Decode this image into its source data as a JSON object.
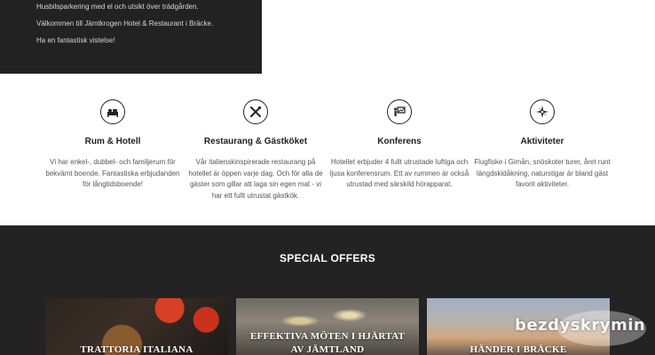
{
  "intro": {
    "lines": [
      "Husbilsparkering med el och utsikt över trädgården.",
      "Välkommen till Jämtkrogen Hotel & Restaurant i Bräcke.",
      "Ha en fantastisk vistelse!"
    ]
  },
  "features": [
    {
      "icon": "bed-icon",
      "title": "Rum & Hotell",
      "desc": "Vi har enkel-, dubbel- och familjerum för bekvämt boende. Fantastiska erbjudanden för långtidsboende!"
    },
    {
      "icon": "cutlery-icon",
      "title": "Restaurang & Gästköket",
      "desc": "Vår italienskinspirerade restaurang på hotellet är öppen varje dag. Och för alla de gäster som gillar att laga sin egen mat - vi har ett fullt utrustat gästkök."
    },
    {
      "icon": "presentation-icon",
      "title": "Konferens",
      "desc": "Hotellet erbjuder 4 fullt utrustade luftiga och ljusa konferensrum. Ett av rummen är också utrustad med särskild hörapparat."
    },
    {
      "icon": "compass-icon",
      "title": "Aktiviteter",
      "desc": "Flugfiske i Gimån, snöskoter turer, året runt längdskidåkning, naturstigar är bland gäst favorit aktiviteter."
    }
  ],
  "offers": {
    "title": "SPECIAL OFFERS",
    "cards": [
      {
        "label": "TRATTORIA ITALIANA"
      },
      {
        "label": "EFFEKTIVA MÖTEN I HJÄRTAT AV JÄMTLAND"
      },
      {
        "label": "HÄNDER I BRÄCKE"
      }
    ]
  },
  "watermark": "bezdyskrymin"
}
